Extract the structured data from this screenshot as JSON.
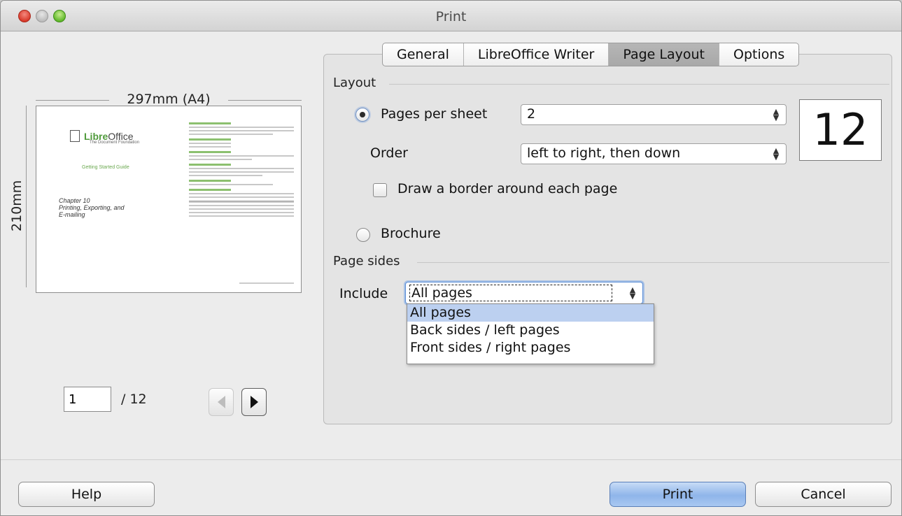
{
  "window": {
    "title": "Print"
  },
  "preview": {
    "width_label": "297mm (A4)",
    "height_label": "210mm",
    "thumb": {
      "logo_prefix": "Libre",
      "logo_suffix": "Office",
      "foundation": "The Document Foundation",
      "guide": "Getting Started Guide",
      "chapter": "Chapter 10",
      "chapter_sub1": "Printing, Exporting, and",
      "chapter_sub2": "E-mailing"
    },
    "pager": {
      "current": "1",
      "total_label": "/ 12"
    }
  },
  "tabs": [
    {
      "label": "General"
    },
    {
      "label": "LibreOffice Writer"
    },
    {
      "label": "Page Layout",
      "active": true
    },
    {
      "label": "Options"
    }
  ],
  "layout": {
    "section_label": "Layout",
    "pages_per_sheet_label": "Pages per sheet",
    "pages_per_sheet_value": "2",
    "order_label": "Order",
    "order_value": "left to right, then down",
    "border_label": "Draw a border around each page",
    "brochure_label": "Brochure",
    "page_count": "12"
  },
  "page_sides": {
    "section_label": "Page sides",
    "include_label": "Include",
    "include_value": "All pages",
    "options": [
      "All pages",
      "Back sides / left pages",
      "Front sides / right pages"
    ]
  },
  "buttons": {
    "help": "Help",
    "print": "Print",
    "cancel": "Cancel"
  }
}
